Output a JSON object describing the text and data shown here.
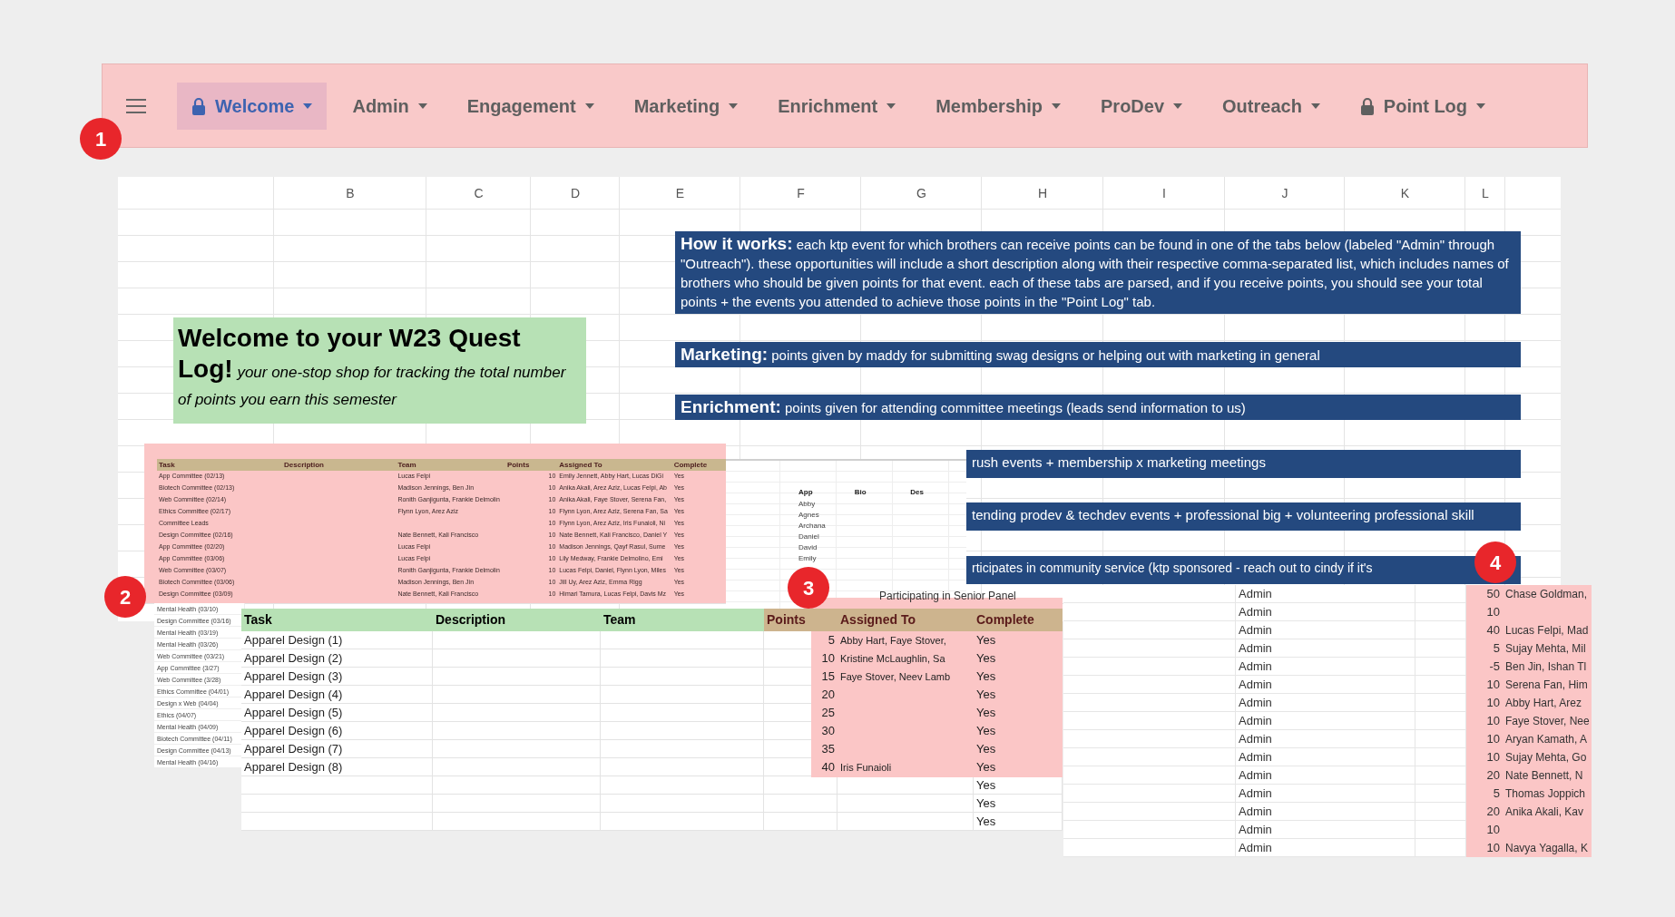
{
  "menu_bar": {
    "tabs": [
      {
        "label": "Welcome",
        "locked": true,
        "selected": true
      },
      {
        "label": "Admin",
        "locked": false,
        "selected": false
      },
      {
        "label": "Engagement",
        "locked": false,
        "selected": false
      },
      {
        "label": "Marketing",
        "locked": false,
        "selected": false
      },
      {
        "label": "Enrichment",
        "locked": false,
        "selected": false
      },
      {
        "label": "Membership",
        "locked": false,
        "selected": false
      },
      {
        "label": "ProDev",
        "locked": false,
        "selected": false
      },
      {
        "label": "Outreach",
        "locked": false,
        "selected": false
      },
      {
        "label": "Point Log",
        "locked": true,
        "selected": false
      }
    ]
  },
  "callouts": [
    "1",
    "2",
    "3",
    "4"
  ],
  "sheet": {
    "columns": [
      "B",
      "C",
      "D",
      "E",
      "F",
      "G",
      "H",
      "I",
      "J",
      "K",
      "L"
    ],
    "welcome": "**Welcome to your W23 Quest Log!** *your one-stop shop for tracking the total number of points you earn this semester*",
    "info_boxes": [
      {
        "text": "**How it works:** each ktp event for which brothers can receive points can be found in one of the tabs below (labeled \"Admin\" through \"Outreach\"). these opportunities will include a short description along with their respective comma-separated list, which includes names of brothers who should be given points for that event. each of these tabs are parsed, and if you receive points, you should see your total points + the events you attended to achieve those points in the \"Point Log\" tab."
      },
      {
        "text": "**Marketing:** points given by maddy for submitting swag designs or helping out with marketing in general"
      },
      {
        "text": "**Enrichment:** points given for attending committee meetings (leads send information to us)"
      },
      {
        "text": "rush events + membership x marketing meetings"
      },
      {
        "text": "tending prodev & techdev events + professional big + volunteering professional skill"
      },
      {
        "text": "rticipates in community service (ktp sponsored - reach out to cindy if it's"
      }
    ]
  },
  "committee_table": {
    "columns": [
      "Task",
      "Description",
      "Team",
      "Points",
      "Assigned To",
      "Complete"
    ],
    "rows": [
      {
        "task": "App Committee (02/13)",
        "team": "Lucas Felpi",
        "points": "10",
        "assigned_to": "Emily Jennett, Abby Hart, Lucas DiGi",
        "complete": "Yes"
      },
      {
        "task": "Biotech Committee (02/13)",
        "team": "Madison Jennings, Ben Jin",
        "points": "10",
        "assigned_to": "Anika Akali, Arez Aziz, Lucas Felpi, Ab",
        "complete": "Yes"
      },
      {
        "task": "Web Committee (02/14)",
        "team": "Ronith Ganjigunta, Frankie Delmolin",
        "points": "10",
        "assigned_to": "Anika Akali, Faye Stover, Serena Fan,",
        "complete": "Yes"
      },
      {
        "task": "Ethics Committee (02/17)",
        "team": "Flynn Lyon, Arez Aziz",
        "points": "10",
        "assigned_to": "Flynn Lyon, Arez Aziz, Serena Fan, Sa",
        "complete": "Yes"
      },
      {
        "task": "Committee Leads",
        "points": "10",
        "assigned_to": "Flynn Lyon, Arez Aziz, Iris Funaioli, Ni",
        "complete": "Yes"
      },
      {
        "task": "Design Committee (02/16)",
        "team": "Nate Bennett, Kali Francisco",
        "points": "10",
        "assigned_to": "Nate Bennett, Kali Francisco, Daniel Y",
        "complete": "Yes"
      },
      {
        "task": "App Committee (02/20)",
        "team": "Lucas Felpi",
        "points": "10",
        "assigned_to": "Madison Jennings, Qayf Rasul, Sume",
        "complete": "Yes"
      },
      {
        "task": "App Committee (03/06)",
        "team": "Lucas Felpi",
        "points": "10",
        "assigned_to": "Lily Medway, Frankie Delmolino, Emi",
        "complete": "Yes"
      },
      {
        "task": "Web Committee (03/07)",
        "team": "Ronith Ganjigunta, Frankie Delmolin",
        "points": "10",
        "assigned_to": "Lucas Felpi, Daniel, Flynn Lyon, Miles",
        "complete": "Yes"
      },
      {
        "task": "Biotech Committee (03/06)",
        "team": "Madison Jennings, Ben Jin",
        "points": "10",
        "assigned_to": "Jill Uy, Arez Aziz, Emma Rigg",
        "complete": "Yes"
      },
      {
        "task": "Design Committee (03/09)",
        "team": "Nate Bennett, Kali Francisco",
        "points": "10",
        "assigned_to": "Himari Tamura, Lucas Felpi, Davis Mz",
        "complete": "Yes"
      }
    ],
    "more_tasks": [
      "Mental Health (03/10)",
      "Design Committee (03/16)",
      "Mental Health (03/19)",
      "Mental Health (03/26)",
      "Web Committee (03/21)",
      "App Committee (3/27)",
      "Web Committee (3/28)",
      "Ethics Committee (04/01)",
      "Design x Web (04/04)",
      "Ethics (04/07)",
      "Mental Health (04/09)",
      "Biotech Committee (04/11)",
      "Design Committee (04/13)",
      "Mental Health (04/16)"
    ]
  },
  "names_table": {
    "columns": [
      "App",
      "Bio",
      "Des"
    ],
    "names": [
      "Abby",
      "Agnes",
      "Archana",
      "Daniel",
      "David",
      "Emily"
    ]
  },
  "senior_panel": "Participating in Senior Panel",
  "apparel_table": {
    "columns": [
      "Task",
      "Description",
      "Team",
      "Points",
      "Assigned To",
      "Complete"
    ],
    "rows": [
      {
        "task": "Apparel Design (1)",
        "points": "5",
        "assigned_to": "Abby Hart, Faye Stover,",
        "complete": "Yes"
      },
      {
        "task": "Apparel Design (2)",
        "points": "10",
        "assigned_to": "Kristine McLaughlin, Sa",
        "complete": "Yes"
      },
      {
        "task": "Apparel Design (3)",
        "points": "15",
        "assigned_to": "Faye Stover, Neev Lamb",
        "complete": "Yes"
      },
      {
        "task": "Apparel Design (4)",
        "points": "20",
        "complete": "Yes"
      },
      {
        "task": "Apparel Design (5)",
        "points": "25",
        "complete": "Yes"
      },
      {
        "task": "Apparel Design (6)",
        "points": "30",
        "complete": "Yes"
      },
      {
        "task": "Apparel Design (7)",
        "points": "35",
        "complete": "Yes"
      },
      {
        "task": "Apparel Design (8)",
        "points": "40",
        "assigned_to": "Iris Funaioli",
        "complete": "Yes"
      },
      {
        "complete": "Yes"
      },
      {
        "complete": "Yes"
      },
      {
        "complete": "Yes"
      }
    ]
  },
  "admin_table": {
    "rows": [
      {
        "team": "Admin",
        "points": "50",
        "assigned_to": "Chase Goldman,"
      },
      {
        "team": "Admin",
        "points": "10"
      },
      {
        "team": "Admin",
        "points": "40",
        "assigned_to": "Lucas Felpi, Mad"
      },
      {
        "team": "Admin",
        "points": "5",
        "assigned_to": "Sujay Mehta, Mil"
      },
      {
        "team": "Admin",
        "points": "-5",
        "assigned_to": "Ben Jin, Ishan Tl"
      },
      {
        "team": "Admin",
        "points": "10",
        "assigned_to": "Serena Fan, Him"
      },
      {
        "team": "Admin",
        "points": "10",
        "assigned_to": "Abby Hart, Arez"
      },
      {
        "team": "Admin",
        "points": "10",
        "assigned_to": "Faye Stover, Nee"
      },
      {
        "team": "Admin",
        "points": "10",
        "assigned_to": "Aryan Kamath, A"
      },
      {
        "team": "Admin",
        "points": "10",
        "assigned_to": "Sujay Mehta, Go"
      },
      {
        "team": "Admin",
        "points": "20",
        "assigned_to": "Nate Bennett, N"
      },
      {
        "team": "Admin",
        "points": "5",
        "assigned_to": "Thomas Joppich"
      },
      {
        "team": "Admin",
        "points": "20",
        "assigned_to": "Anika Akali, Kav"
      },
      {
        "team": "Admin",
        "points": "10"
      },
      {
        "team": "Admin",
        "points": "10",
        "assigned_to": "Navya Yagalla, K"
      }
    ]
  }
}
